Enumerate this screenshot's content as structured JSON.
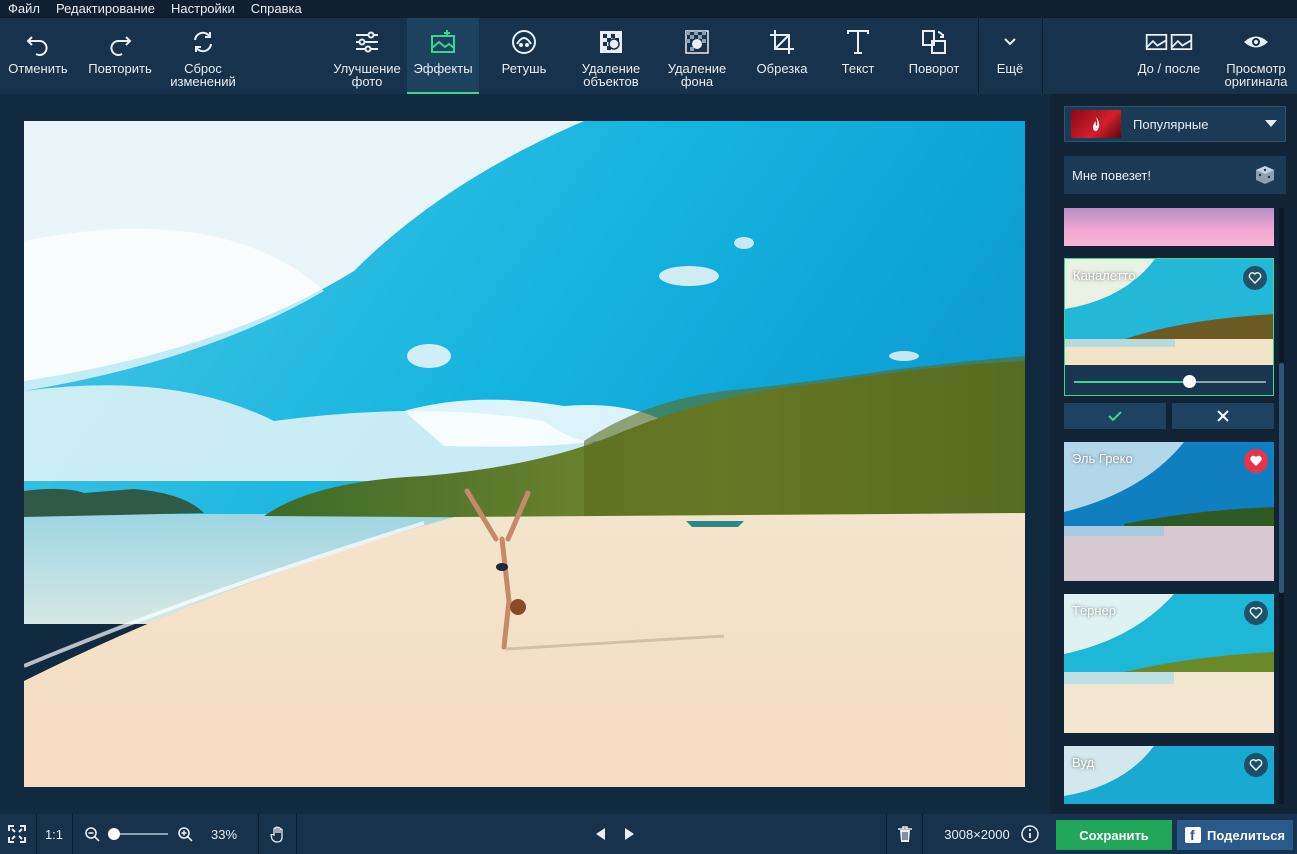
{
  "menu": [
    "Файл",
    "Редактирование",
    "Настройки",
    "Справка"
  ],
  "toolbar": {
    "undo": "Отменить",
    "redo": "Повторить",
    "reset": "Сброс\nизменений",
    "enhance": "Улучшение\nфото",
    "effects": "Эффекты",
    "retouch": "Ретушь",
    "remove_objects": "Удаление\nобъектов",
    "remove_bg": "Удаление\nфона",
    "crop": "Обрезка",
    "text": "Текст",
    "rotate": "Поворот",
    "more": "Ещё",
    "before_after": "До / после",
    "preview": "Просмотр\nоригинала"
  },
  "panel": {
    "category": "Популярные",
    "lucky": "Мне повезет!",
    "effects": [
      {
        "name": "Каналетто",
        "favorite": false,
        "selected": true,
        "intensity": 0.6
      },
      {
        "name": "Эль Греко",
        "favorite": true
      },
      {
        "name": "Тёрнер",
        "favorite": false
      },
      {
        "name": "Вуд",
        "favorite": false
      }
    ]
  },
  "bottom": {
    "ratio": "1:1",
    "zoom": "33%",
    "zoom_level": 0.1,
    "dimensions": "3008×2000",
    "save": "Сохранить",
    "share": "Поделиться"
  },
  "colors": {
    "accent": "#3fd38d",
    "save": "#21a65a",
    "share": "#2a5a8a",
    "favorite": "#e8344b"
  }
}
